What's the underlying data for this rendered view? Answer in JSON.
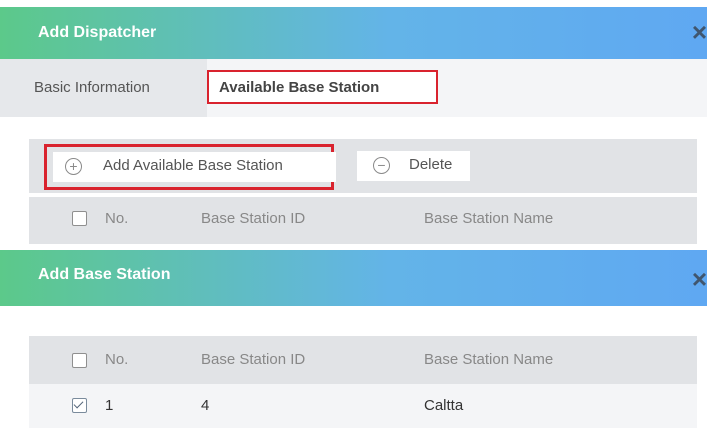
{
  "dispatcher_dialog": {
    "title": "Add Dispatcher",
    "close_glyph": "×",
    "tabs": [
      {
        "label": "Basic Information",
        "active": false
      },
      {
        "label": "Available Base Station",
        "active": true
      }
    ],
    "toolbar": {
      "add_label": "Add Available Base Station",
      "delete_label": "Delete",
      "add_icon": "plus-circle-icon",
      "delete_icon": "minus-circle-icon"
    },
    "table": {
      "columns": [
        "No.",
        "Base Station ID",
        "Base Station Name"
      ]
    }
  },
  "base_station_dialog": {
    "title": "Add Base Station",
    "close_glyph": "×",
    "table": {
      "columns": [
        "No.",
        "Base Station ID",
        "Base Station Name"
      ],
      "rows": [
        {
          "no": "1",
          "id": "4",
          "name": "Caltta",
          "checked": true
        }
      ]
    }
  },
  "colors": {
    "header_gradient_start": "#5cc98a",
    "header_gradient_end": "#5fa8f2",
    "highlight_border": "#d9232e"
  }
}
